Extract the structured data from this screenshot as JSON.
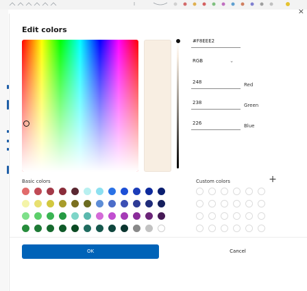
{
  "window": {
    "close_glyph": "×"
  },
  "dialog": {
    "title": "Edit colors"
  },
  "current_color": {
    "hex": "#F8EEE2",
    "mode": "RGB",
    "red": "248",
    "green": "238",
    "blue": "226",
    "red_label": "Red",
    "green_label": "Green",
    "blue_label": "Blue"
  },
  "basic_colors": {
    "label": "Basic colors",
    "swatches": [
      "#e16b6b",
      "#c04a55",
      "#a33a48",
      "#8a2d3a",
      "#5a2731",
      "#b8f0f0",
      "#8ce0f0",
      "#2a72e6",
      "#1c4fd6",
      "#1b3cb8",
      "#0d2a9c",
      "#0a1e70",
      "#f4f4a8",
      "#e8e070",
      "#d2c83f",
      "#a89c2a",
      "#7a6f1f",
      "#6c6c20",
      "#5d8dd6",
      "#4c6dc9",
      "#3b4fb4",
      "#2e3b96",
      "#1f2c7a",
      "#151f5d",
      "#7ee08a",
      "#5ccf6a",
      "#3ab453",
      "#259a43",
      "#7dd5c8",
      "#5ab8ad",
      "#d46bd8",
      "#c14fd0",
      "#a53bb6",
      "#8a2c9a",
      "#6b2578",
      "#461a56",
      "#268c3b",
      "#1e7a35",
      "#166a2e",
      "#0f5a28",
      "#0b4a22",
      "#1f6b5f",
      "#17594e",
      "#0f463e",
      "#0b352f",
      "#888888",
      "#c2c2c2",
      "#ffffff"
    ]
  },
  "custom_colors": {
    "label": "Custom colors",
    "add_glyph": "+"
  },
  "actions": {
    "ok": "OK",
    "cancel": "Cancel"
  },
  "icons": {
    "close": "close-icon",
    "add": "plus-icon",
    "dropdown": "chevron-down-icon"
  }
}
